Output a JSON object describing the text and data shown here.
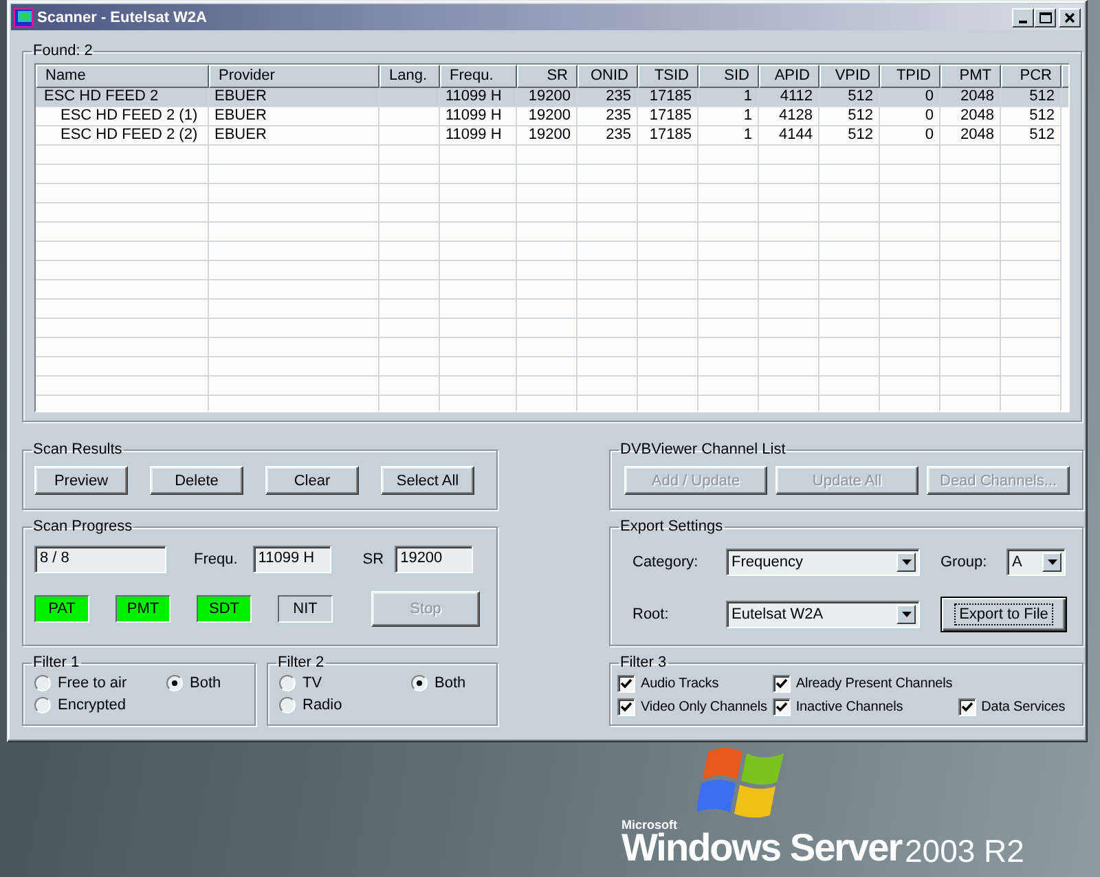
{
  "window": {
    "title": "Scanner - Eutelsat W2A"
  },
  "found": {
    "title": "Found:  2"
  },
  "table": {
    "columns": [
      "Name",
      "Provider",
      "Lang.",
      "Frequ.",
      "SR",
      "ONID",
      "TSID",
      "SID",
      "APID",
      "VPID",
      "TPID",
      "PMT",
      "PCR"
    ],
    "rows": [
      {
        "selected": true,
        "cells": [
          "ESC HD FEED 2",
          "EBUER",
          "",
          "11099 H",
          "19200",
          "235",
          "17185",
          "1",
          "4112",
          "512",
          "0",
          "2048",
          "512"
        ],
        "children": [
          {
            "selected": false,
            "cells": [
              "ESC HD FEED 2 (1)",
              "EBUER",
              "",
              "11099 H",
              "19200",
              "235",
              "17185",
              "1",
              "4128",
              "512",
              "0",
              "2048",
              "512"
            ]
          },
          {
            "selected": false,
            "cells": [
              "ESC HD FEED 2 (2)",
              "EBUER",
              "",
              "11099 H",
              "19200",
              "235",
              "17185",
              "1",
              "4144",
              "512",
              "0",
              "2048",
              "512"
            ]
          }
        ]
      }
    ]
  },
  "scan_results": {
    "title": "Scan Results",
    "buttons": [
      {
        "label": "Preview",
        "disabled": false
      },
      {
        "label": "Delete",
        "disabled": false
      },
      {
        "label": "Clear",
        "disabled": false
      },
      {
        "label": "Select All",
        "disabled": false
      }
    ]
  },
  "channel_list": {
    "title": "DVBViewer Channel List",
    "buttons": [
      {
        "label": "Add / Update",
        "disabled": true
      },
      {
        "label": "Update All",
        "disabled": true
      },
      {
        "label": "Dead Channels...",
        "disabled": true
      }
    ]
  },
  "scan_progress": {
    "title": "Scan Progress",
    "progress": "8 / 8",
    "frequency": {
      "label": "Frequ.",
      "value": "11099 H"
    },
    "sr": {
      "label": "SR",
      "value": "19200"
    },
    "tables": [
      {
        "label": "PAT",
        "found": true
      },
      {
        "label": "PMT",
        "found": true
      },
      {
        "label": "SDT",
        "found": true
      },
      {
        "label": "NIT",
        "found": false
      }
    ],
    "stop_button": {
      "label": "Stop",
      "disabled": true
    }
  },
  "export_settings": {
    "title": "Export Settings",
    "category": {
      "label": "Category:",
      "value": "Frequency"
    },
    "group": {
      "label": "Group:",
      "value": "A"
    },
    "root": {
      "label": "Root:",
      "value": "Eutelsat W2A"
    },
    "export_button": {
      "label": "Export to File",
      "default": true
    }
  },
  "filter_1": {
    "title": "Filter 1",
    "options": [
      {
        "label": "Free to air",
        "selected": false
      },
      {
        "label": "Both",
        "selected": true
      },
      {
        "label": "Encrypted",
        "selected": false
      }
    ]
  },
  "filter_2": {
    "title": "Filter 2",
    "options": [
      {
        "label": "TV",
        "selected": false
      },
      {
        "label": "Both",
        "selected": true
      },
      {
        "label": "Radio",
        "selected": false
      }
    ]
  },
  "filter_3": {
    "title": "Filter 3",
    "options": [
      {
        "label": "Audio Tracks",
        "checked": true
      },
      {
        "label": "Already Present Channels",
        "checked": true
      },
      {
        "label": "Video Only Channels",
        "checked": true
      },
      {
        "label": "Inactive Channels",
        "checked": true
      },
      {
        "label": "Data Services",
        "checked": true
      }
    ]
  },
  "desktop": {
    "brand": "Microsoft",
    "product": "Windows Server",
    "version": "2003 R2"
  }
}
